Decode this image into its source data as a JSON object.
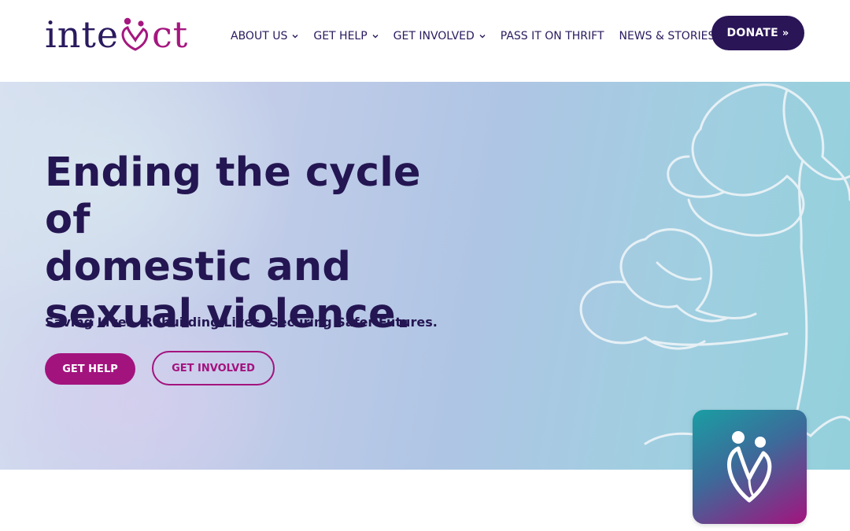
{
  "logo": {
    "pre": "inte",
    "post": "ct",
    "aria_label": "interact"
  },
  "nav": {
    "items": [
      {
        "label": "ABOUT US",
        "has_dropdown": true
      },
      {
        "label": "GET HELP",
        "has_dropdown": true
      },
      {
        "label": "GET INVOLVED",
        "has_dropdown": true
      },
      {
        "label": "PASS IT ON THRIFT",
        "has_dropdown": false
      },
      {
        "label": "NEWS & STORIES",
        "has_dropdown": false
      }
    ],
    "donate_label": "DONATE",
    "donate_icon": "double-chevron-right-icon"
  },
  "hero": {
    "title_lines": [
      "Ending the cycle of",
      "domestic and",
      "sexual violence."
    ],
    "subtitle": "Saving Lives. Rebuilding Lives. Securing Safer Futures.",
    "primary_button": "GET HELP",
    "secondary_button": "GET INVOLVED"
  },
  "colors": {
    "navy": "#241652",
    "magenta": "#a3137e",
    "donate_bg": "#2a1557",
    "hero_gradient_start": "#d6dff0",
    "hero_gradient_end": "#93d0dc"
  },
  "app_tile": {
    "icon": "family-heart-icon"
  }
}
